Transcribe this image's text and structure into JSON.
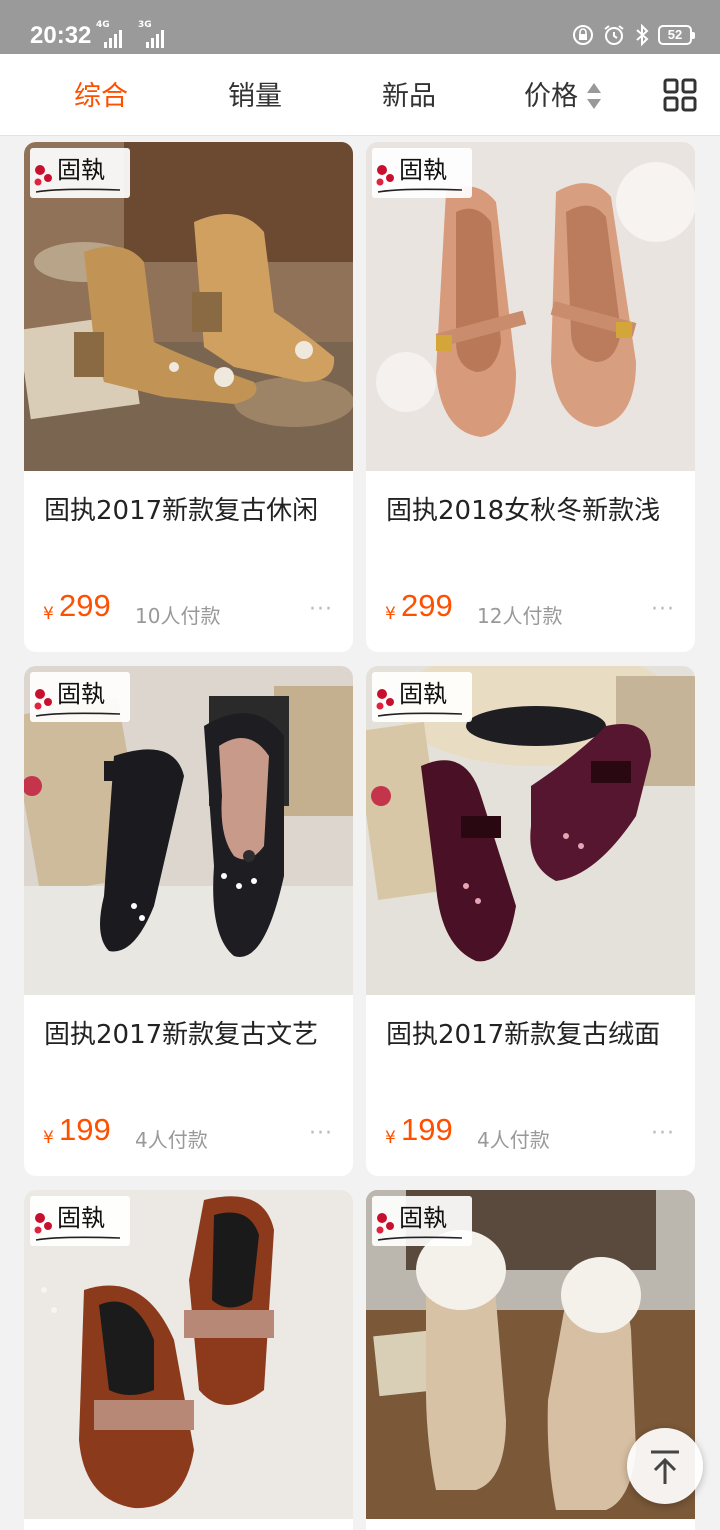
{
  "status_bar": {
    "time": "20:32",
    "network_1": "4G",
    "network_2": "3G",
    "battery": "52"
  },
  "sort_tabs": [
    {
      "label": "综合",
      "active": true
    },
    {
      "label": "销量",
      "active": false
    },
    {
      "label": "新品",
      "active": false
    },
    {
      "label": "价格",
      "active": false
    }
  ],
  "brand_logo_text": "固執",
  "products": [
    {
      "title": "固执2017新款复古休闲",
      "currency": "¥",
      "price": "299",
      "sold": "10人付款",
      "image": "tan-suede-embroidered-ankle-boots"
    },
    {
      "title": "固执2018女秋冬新款浅",
      "currency": "¥",
      "price": "299",
      "sold": "12人付款",
      "image": "pink-leather-mary-jane-flats"
    },
    {
      "title": "固执2017新款复古文艺",
      "currency": "¥",
      "price": "199",
      "sold": "4人付款",
      "image": "black-velvet-bow-heels"
    },
    {
      "title": "固执2017新款复古绒面",
      "currency": "¥",
      "price": "199",
      "sold": "4人付款",
      "image": "burgundy-velvet-embroidered-heels"
    },
    {
      "title": "",
      "currency": "",
      "price": "",
      "sold": "",
      "image": "brown-leather-bow-loafers"
    },
    {
      "title": "",
      "currency": "",
      "price": "",
      "sold": "",
      "image": "beige-fur-cuff-boots"
    }
  ],
  "more_label": "···",
  "colors": {
    "accent": "#ff5000",
    "price": "#ff5000",
    "background": "#f2f2f2"
  }
}
